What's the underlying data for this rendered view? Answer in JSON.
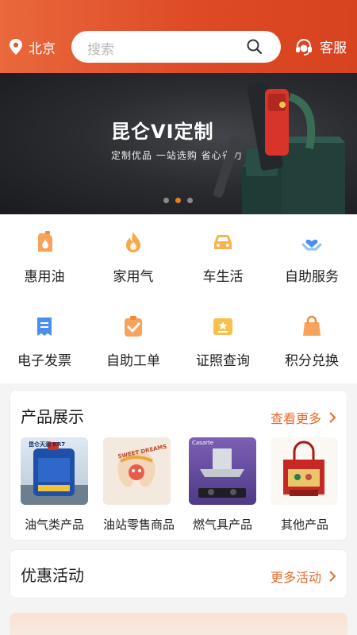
{
  "header": {
    "location": "北京",
    "search_placeholder": "搜索",
    "service_label": "客服"
  },
  "banner": {
    "title": "昆仑VI定制",
    "subtitle": "定制优品 一站选购 省心省力",
    "slide_count": 3,
    "active_slide": 2
  },
  "quick_menu": [
    {
      "label": "惠用油",
      "icon": "fuel-can-icon"
    },
    {
      "label": "家用气",
      "icon": "flame-icon"
    },
    {
      "label": "车生活",
      "icon": "car-icon"
    },
    {
      "label": "自助服务",
      "icon": "hand-heart-icon"
    },
    {
      "label": "电子发票",
      "icon": "invoice-icon"
    },
    {
      "label": "自助工单",
      "icon": "clipboard-check-icon"
    },
    {
      "label": "证照查询",
      "icon": "certificate-icon"
    },
    {
      "label": "积分兑换",
      "icon": "shopping-bag-icon"
    }
  ],
  "products": {
    "title": "产品展示",
    "more_label": "查看更多",
    "items": [
      {
        "label": "油气类产品",
        "image_text": "昆仑天润 KR7"
      },
      {
        "label": "油站零售商品",
        "image_text": "SWEET DREAMS"
      },
      {
        "label": "燃气具产品",
        "image_text": "Casarte"
      },
      {
        "label": "其他产品",
        "image_text": ""
      }
    ]
  },
  "promotions": {
    "title": "优惠活动",
    "more_label": "更多活动"
  },
  "colors": {
    "header_orange": "#de4a26",
    "accent": "#e86a2b",
    "icon_orange": "#f4a35c"
  }
}
